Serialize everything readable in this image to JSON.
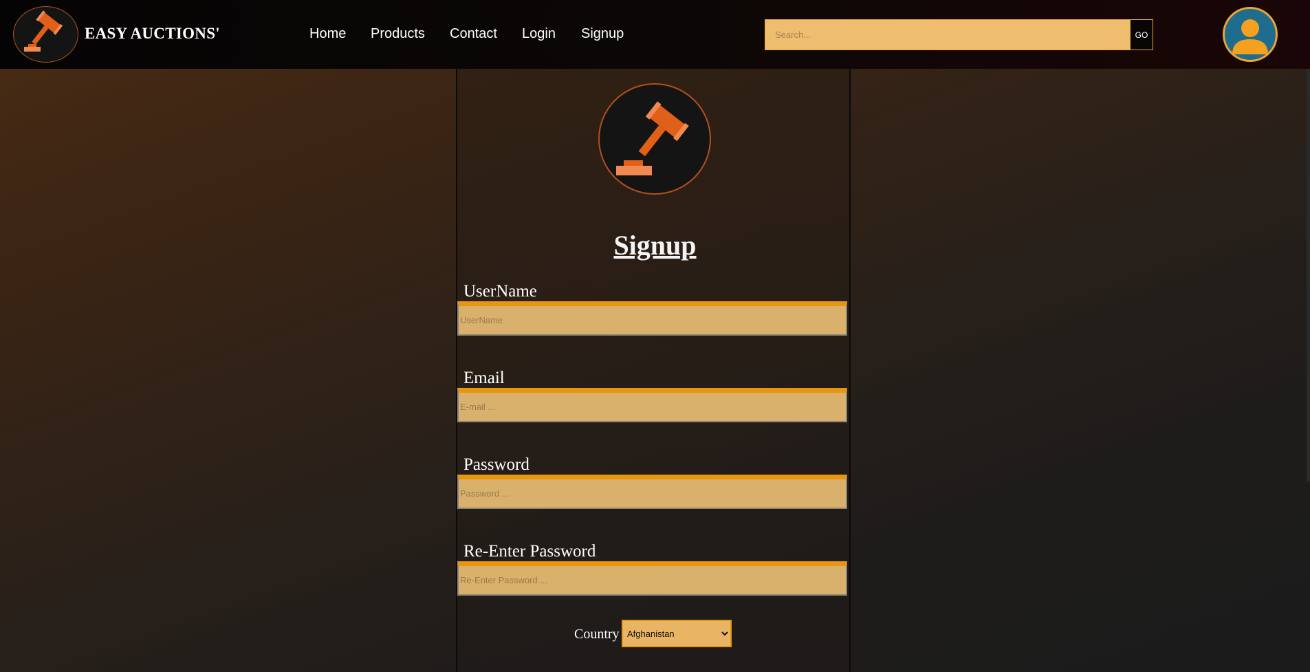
{
  "brand": {
    "name": "EASY AUCTIONS'",
    "logo_icon": "gavel-icon"
  },
  "nav": {
    "home": "Home",
    "products": "Products",
    "contact": "Contact",
    "login": "Login",
    "signup": "Signup"
  },
  "search": {
    "placeholder": "Search...",
    "button_label": "GO"
  },
  "account": {
    "icon": "user-avatar-icon"
  },
  "form": {
    "title": "Signup",
    "username": {
      "label": "UserName",
      "placeholder": "UserName"
    },
    "email": {
      "label": "Email",
      "placeholder": "E-mail ..."
    },
    "password": {
      "label": "Password",
      "placeholder": "Password ..."
    },
    "repassword": {
      "label": "Re-Enter Password",
      "placeholder": "Re-Enter Password ..."
    },
    "country": {
      "label": "Country",
      "selected": "Afghanistan"
    }
  },
  "colors": {
    "accent": "#f0a530",
    "input_bg": "#d9b06c",
    "gavel": "#e0601a",
    "avatar_bg": "#1f6d8e"
  }
}
